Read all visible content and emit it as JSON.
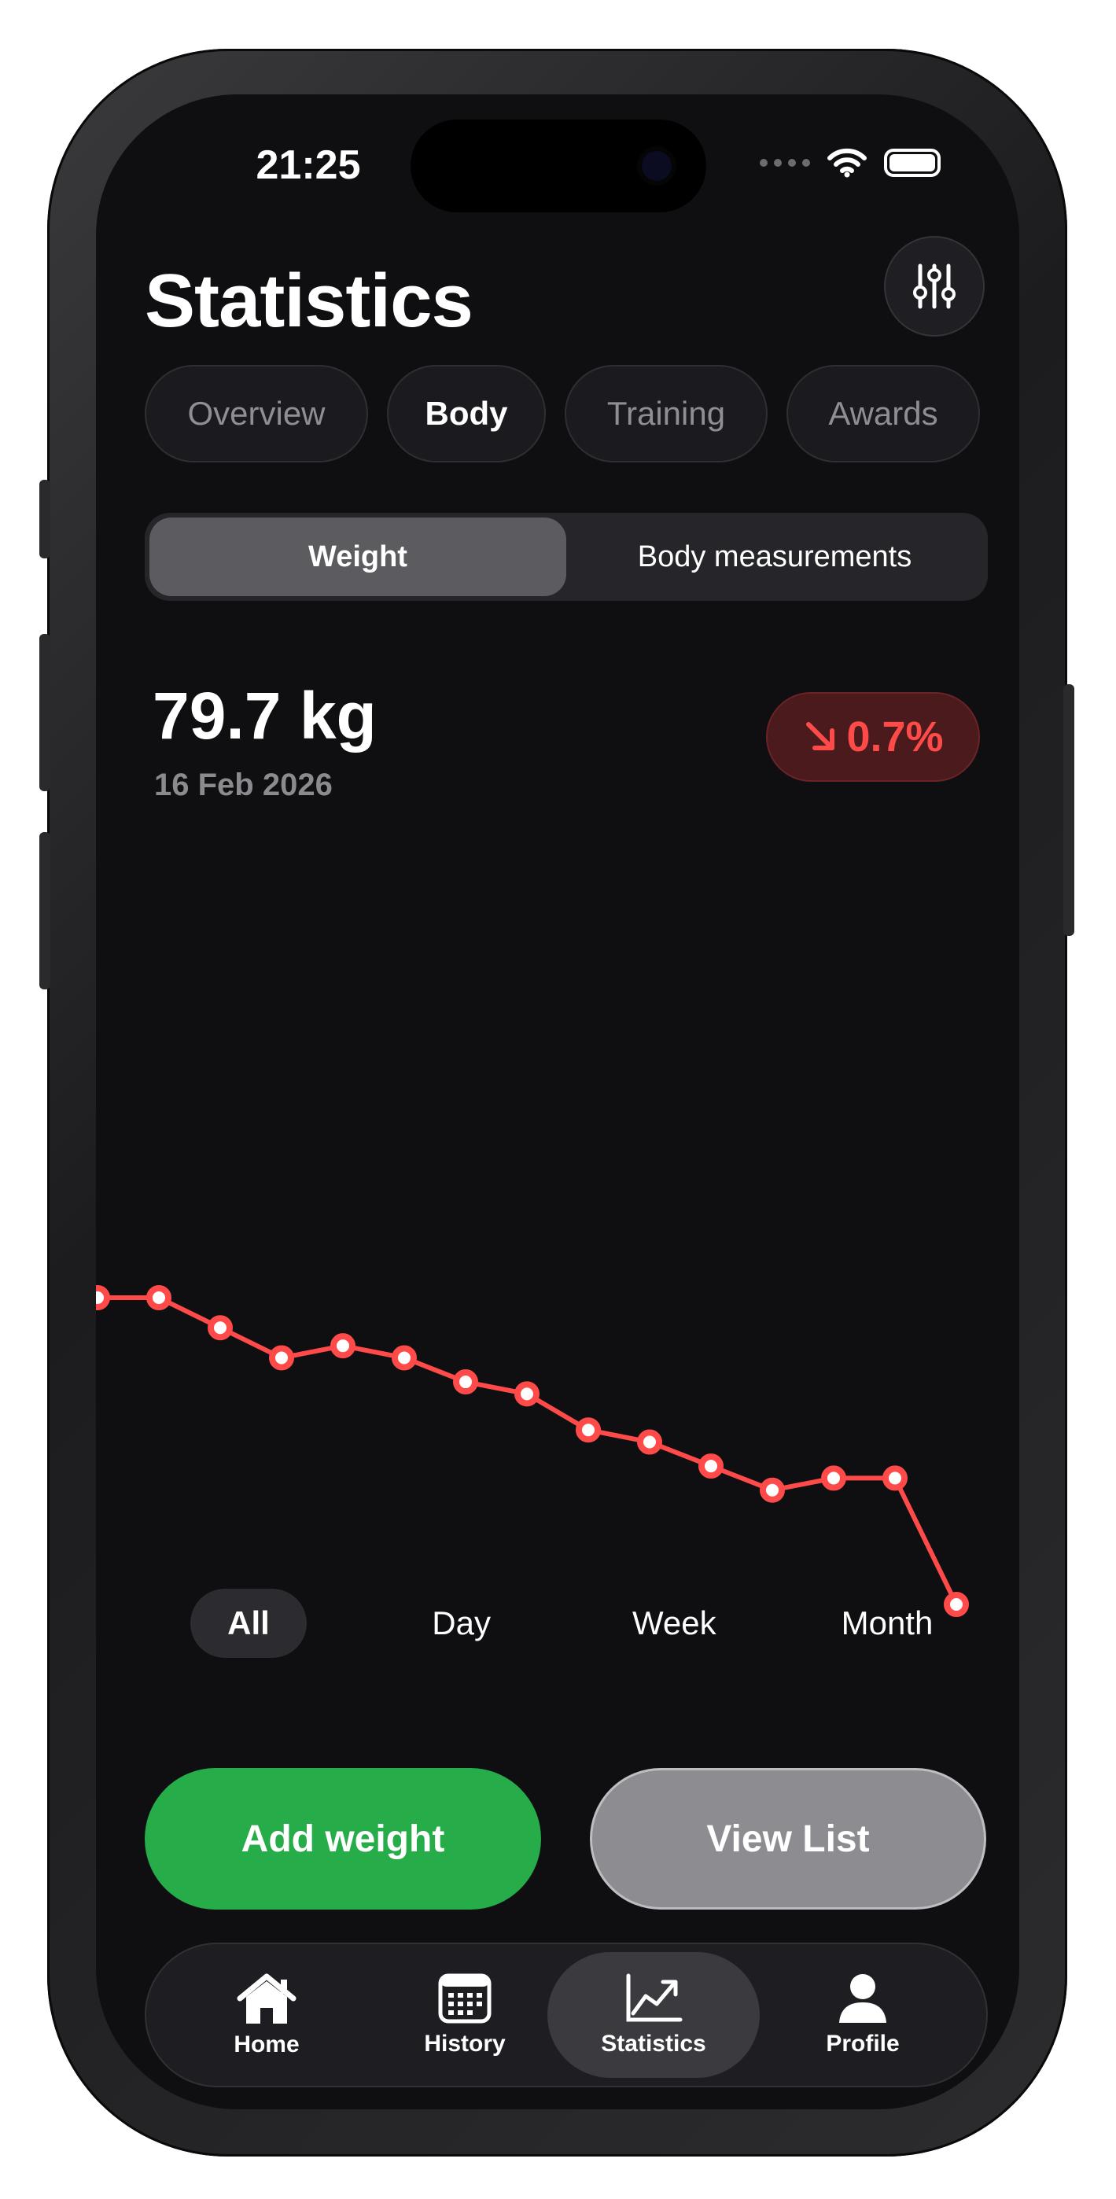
{
  "status_bar": {
    "time": "21:25"
  },
  "header": {
    "title": "Statistics",
    "filter_icon": "sliders-icon"
  },
  "tabs": [
    {
      "label": "Overview",
      "active": false
    },
    {
      "label": "Body",
      "active": true
    },
    {
      "label": "Training",
      "active": false
    },
    {
      "label": "Awards",
      "active": false
    }
  ],
  "segment": [
    {
      "label": "Weight",
      "active": true
    },
    {
      "label": "Body measurements",
      "active": false
    }
  ],
  "summary": {
    "weight": "79.7 kg",
    "date": "16 Feb 2026",
    "change": "0.7%",
    "change_icon": "arrow-down-right-icon",
    "change_color": "#ff4a4a"
  },
  "chart_data": {
    "type": "line",
    "color": "#ff4a4a",
    "values": [
      84.8,
      84.8,
      84.3,
      83.8,
      84.0,
      83.8,
      83.4,
      83.2,
      82.6,
      82.4,
      82.0,
      81.6,
      81.8,
      81.8,
      79.7
    ]
  },
  "ranges": [
    {
      "label": "All",
      "active": true
    },
    {
      "label": "Day",
      "active": false
    },
    {
      "label": "Week",
      "active": false
    },
    {
      "label": "Month",
      "active": false
    }
  ],
  "actions": {
    "add_weight": "Add weight",
    "view_list": "View List",
    "add_color": "#26ac48"
  },
  "tabbar": [
    {
      "label": "Home",
      "icon": "house-icon",
      "active": false
    },
    {
      "label": "History",
      "icon": "calendar-icon",
      "active": false
    },
    {
      "label": "Statistics",
      "icon": "chart-icon",
      "active": true
    },
    {
      "label": "Profile",
      "icon": "person-icon",
      "active": false
    }
  ]
}
